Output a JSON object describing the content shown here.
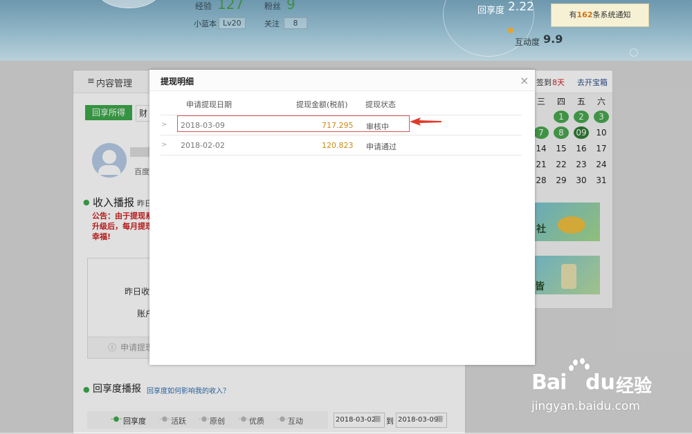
{
  "header": {
    "stats": [
      {
        "label": "经验",
        "value": "127"
      },
      {
        "label": "粉丝",
        "value": "9"
      }
    ],
    "tags": [
      {
        "label": "小蓝本",
        "value": "Lv20"
      },
      {
        "label": "关注",
        "value": "8"
      }
    ],
    "reply_rate_label": "回享度",
    "reply_rate_value": "2.22",
    "interact_label": "互动度",
    "interact_value": "9.9",
    "notice_prefix": "有",
    "notice_count": "162",
    "notice_suffix": "条系统通知"
  },
  "left": {
    "section_title": "内容管理",
    "tabs": [
      "回享所得",
      "财"
    ],
    "profile_sub": "百度",
    "income_title": "收入播报",
    "income_sub": "昨日",
    "notice_lines": [
      "公告：由于提现系",
      "升级后，每月提现",
      "幸福!"
    ],
    "yesterday": "昨日收",
    "account": "账户",
    "apply_link": "申请提现",
    "reply_title": "回享度播报",
    "reply_link": "回享度如何影响我的收入？",
    "filters": [
      "回享度",
      "活跃",
      "原创",
      "优质",
      "互动"
    ],
    "date_from": "2018-03-02",
    "date_to_label": "到",
    "date_to": "2018-03-09"
  },
  "right": {
    "signin_prefix": "签到",
    "signin_days": "8天",
    "treasure": "去开宝箱",
    "weekdays": [
      "三",
      "四",
      "五",
      "六"
    ],
    "rows": [
      [
        "",
        "1",
        "2",
        "3"
      ],
      [
        "7",
        "8",
        "09",
        "10"
      ],
      [
        "14",
        "15",
        "16",
        "17"
      ],
      [
        "21",
        "22",
        "23",
        "24"
      ],
      [
        "28",
        "29",
        "30",
        "31"
      ]
    ],
    "ad1_text": "社",
    "ad2_text": "皆"
  },
  "modal": {
    "title": "提现明细",
    "close": "×",
    "headers": [
      "申请提现日期",
      "提现金额(税前)",
      "提现状态"
    ],
    "rows": [
      {
        "date": "2018-03-09",
        "amount": "717.295",
        "status": "审核中"
      },
      {
        "date": "2018-02-02",
        "amount": "120.823",
        "status": "申请通过"
      }
    ]
  },
  "watermark": {
    "brand": "Bai",
    "brand2": "du",
    "cn": "经验",
    "url": "jingyan.baidu.com"
  },
  "colors": {
    "accent_green": "#3da84a",
    "amount_orange": "#c98a12",
    "highlight_red": "#d9534f"
  }
}
